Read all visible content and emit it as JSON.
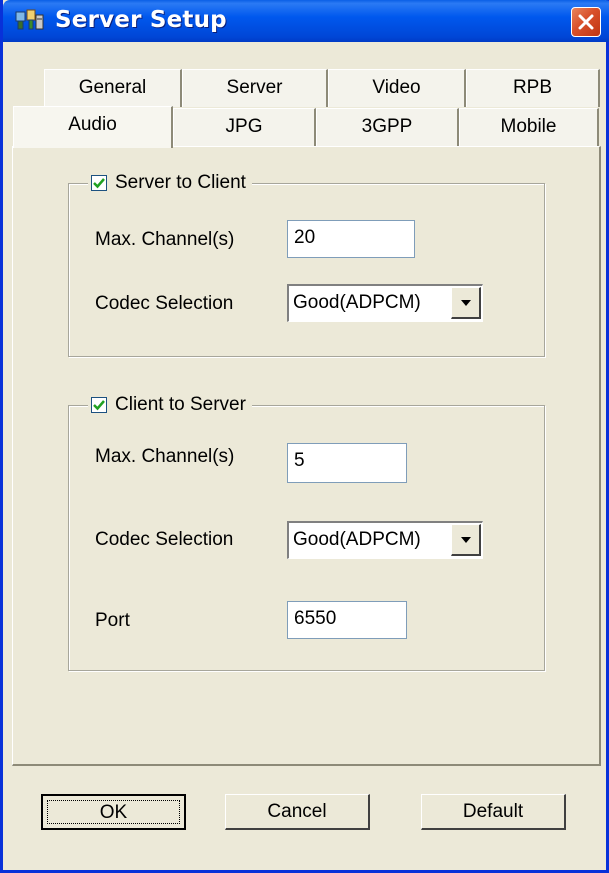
{
  "window": {
    "title": "Server Setup",
    "icon": "server-setup-app-icon",
    "close_icon": "close-icon"
  },
  "tabs": {
    "row1": [
      "General",
      "Server",
      "Video",
      "RPB"
    ],
    "row2": [
      "Audio",
      "JPG",
      "3GPP",
      "Mobile"
    ],
    "active": "Audio"
  },
  "server_to_client": {
    "label": "Server to Client",
    "checked": true,
    "max_channels_label": "Max. Channel(s)",
    "max_channels_value": "20",
    "codec_label": "Codec Selection",
    "codec_value": "Good(ADPCM)"
  },
  "client_to_server": {
    "label": "Client to Server",
    "checked": true,
    "max_channels_label": "Max. Channel(s)",
    "max_channels_value": "5",
    "codec_label": "Codec Selection",
    "codec_value": "Good(ADPCM)",
    "port_label": "Port",
    "port_value": "6550"
  },
  "buttons": {
    "ok": "OK",
    "cancel": "Cancel",
    "default": "Default"
  },
  "colors": {
    "titlebar": "#0058EE",
    "face": "#ECE9D8",
    "close": "#D8502A"
  }
}
